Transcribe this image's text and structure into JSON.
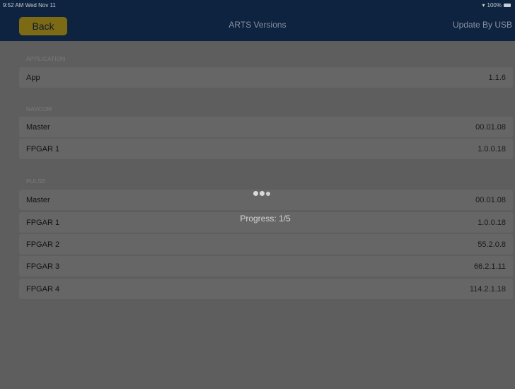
{
  "status_bar": {
    "time_date": "9:52 AM  Wed Nov 11",
    "battery": "100%"
  },
  "nav": {
    "back_label": "Back",
    "title": "ARTS Versions",
    "right_label": "Update By USB"
  },
  "sections": [
    {
      "header": "APPLICATION",
      "rows": [
        {
          "label": "App",
          "value": "1.1.6"
        }
      ]
    },
    {
      "header": "NAVCOM",
      "rows": [
        {
          "label": "Master",
          "value": "00.01.08"
        },
        {
          "label": "FPGAR 1",
          "value": "1.0.0.18"
        }
      ]
    },
    {
      "header": "PULSE",
      "rows": [
        {
          "label": "Master",
          "value": "00.01.08"
        },
        {
          "label": "FPGAR 1",
          "value": "1.0.0.18"
        },
        {
          "label": "FPGAR 2",
          "value": "55.2.0.8"
        },
        {
          "label": "FPGAR 3",
          "value": "66.2.1.11"
        },
        {
          "label": "FPGAR 4",
          "value": "114.2.1.18"
        }
      ]
    }
  ],
  "overlay": {
    "progress_text": "Progress: 1/5"
  }
}
